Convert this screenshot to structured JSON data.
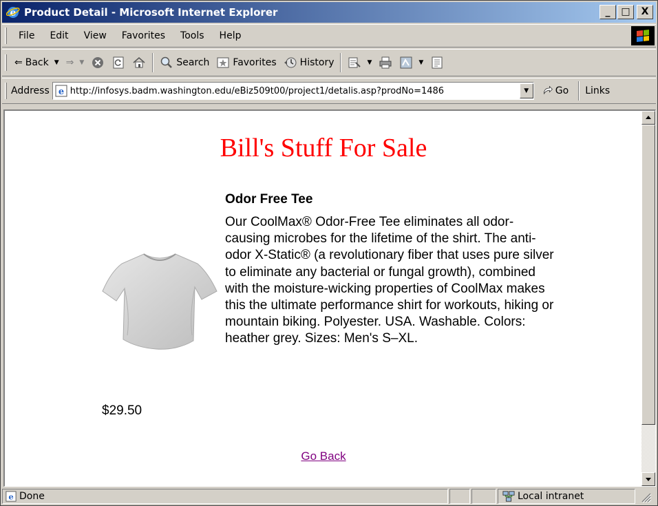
{
  "window": {
    "title": "Product Detail - Microsoft Internet Explorer",
    "controls": {
      "minimize": "_",
      "maximize": "□",
      "close": "X"
    }
  },
  "menu": {
    "items": [
      "File",
      "Edit",
      "View",
      "Favorites",
      "Tools",
      "Help"
    ]
  },
  "toolbar": {
    "back_label": "Back",
    "search_label": "Search",
    "favorites_label": "Favorites",
    "history_label": "History"
  },
  "address": {
    "label": "Address",
    "url": "http://infosys.badm.washington.edu/eBiz509t00/project1/detalis.asp?prodNo=1486",
    "go_label": "Go",
    "links_label": "Links"
  },
  "page": {
    "heading": "Bill's Stuff For Sale",
    "product": {
      "name": "Odor Free Tee",
      "description": "Our CoolMax® Odor-Free Tee eliminates all odor-causing microbes for the lifetime of the shirt. The anti-odor X-Static® (a revolutionary fiber that uses pure silver to eliminate any bacterial or fungal growth), combined with the moisture-wicking properties of CoolMax makes this the ultimate performance shirt for workouts, hiking or mountain biking. Polyester. USA. Washable. Colors: heather grey. Sizes: Men's S–XL.",
      "price": "$29.50"
    },
    "go_back_label": "Go Back"
  },
  "status": {
    "text": "Done",
    "zone": "Local intranet"
  },
  "colors": {
    "heading": "#ff0000",
    "visited_link": "#800080",
    "titlebar_start": "#0a246a",
    "titlebar_end": "#a6caf0"
  }
}
